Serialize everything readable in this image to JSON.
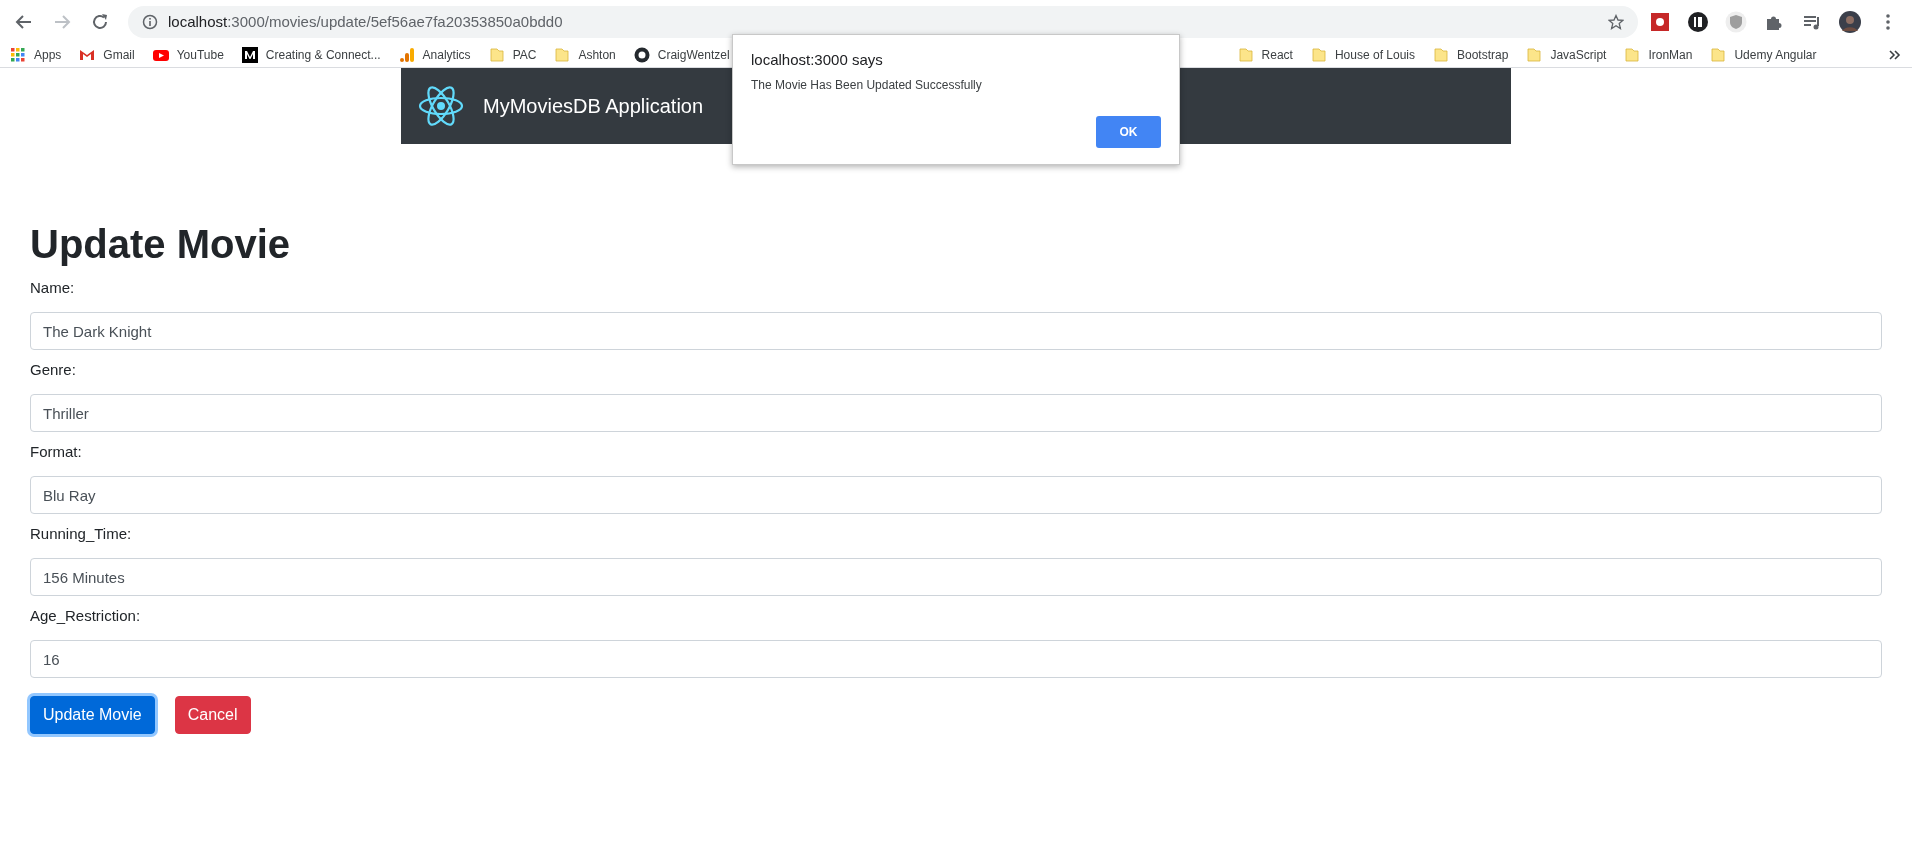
{
  "browser": {
    "url_host": "localhost",
    "url_rest": ":3000/movies/update/5ef56ae7fa20353850a0bdd0",
    "bookmarks": [
      {
        "label": "Apps",
        "kind": "apps"
      },
      {
        "label": "Gmail",
        "kind": "gmail"
      },
      {
        "label": "YouTube",
        "kind": "youtube"
      },
      {
        "label": "Creating & Connect...",
        "kind": "medium"
      },
      {
        "label": "Analytics",
        "kind": "analytics"
      },
      {
        "label": "PAC",
        "kind": "folder"
      },
      {
        "label": "Ashton",
        "kind": "folder"
      },
      {
        "label": "CraigWentzel",
        "kind": "github"
      },
      {
        "label": "React",
        "kind": "folder"
      },
      {
        "label": "House of Louis",
        "kind": "folder"
      },
      {
        "label": "Bootstrap",
        "kind": "folder"
      },
      {
        "label": "JavaScript",
        "kind": "folder"
      },
      {
        "label": "IronMan",
        "kind": "folder"
      },
      {
        "label": "Udemy Angular",
        "kind": "folder"
      }
    ]
  },
  "navbar": {
    "brand": "MyMoviesDB Application"
  },
  "dialog": {
    "title": "localhost:3000 says",
    "message": "The Movie Has Been Updated Successfully",
    "button": "OK"
  },
  "form": {
    "title": "Update Movie",
    "fields": [
      {
        "label": "Name:",
        "value": "The Dark Knight"
      },
      {
        "label": "Genre:",
        "value": "Thriller"
      },
      {
        "label": "Format:",
        "value": "Blu Ray"
      },
      {
        "label": "Running_Time:",
        "value": "156 Minutes"
      },
      {
        "label": "Age_Restriction:",
        "value": "16"
      }
    ],
    "buttons": [
      {
        "label": "Update Movie",
        "kind": "primary",
        "focused": true
      },
      {
        "label": "Cancel",
        "kind": "danger",
        "focused": false
      }
    ]
  }
}
